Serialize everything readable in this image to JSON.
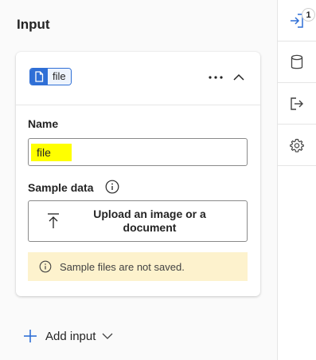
{
  "panel": {
    "title": "Input"
  },
  "input_card": {
    "chip": {
      "icon": "document-icon",
      "label": "file"
    },
    "more_actions_icon": "more-horizontal-icon",
    "collapse_icon": "chevron-up-icon",
    "name_label": "Name",
    "name_value": "file",
    "sample_data_label": "Sample data",
    "upload_button_label": "Upload an image or a document",
    "notice_text": "Sample files are not saved."
  },
  "add_input": {
    "label": "Add input"
  },
  "rail": {
    "items": [
      {
        "icon": "input-arrow-icon",
        "badge": "1",
        "active": true
      },
      {
        "icon": "database-icon"
      },
      {
        "icon": "output-arrow-icon"
      },
      {
        "icon": "gear-icon"
      }
    ]
  },
  "colors": {
    "accent": "#2f6fd6",
    "highlight": "#ffff00",
    "notice_bg": "#fdf2cd"
  }
}
